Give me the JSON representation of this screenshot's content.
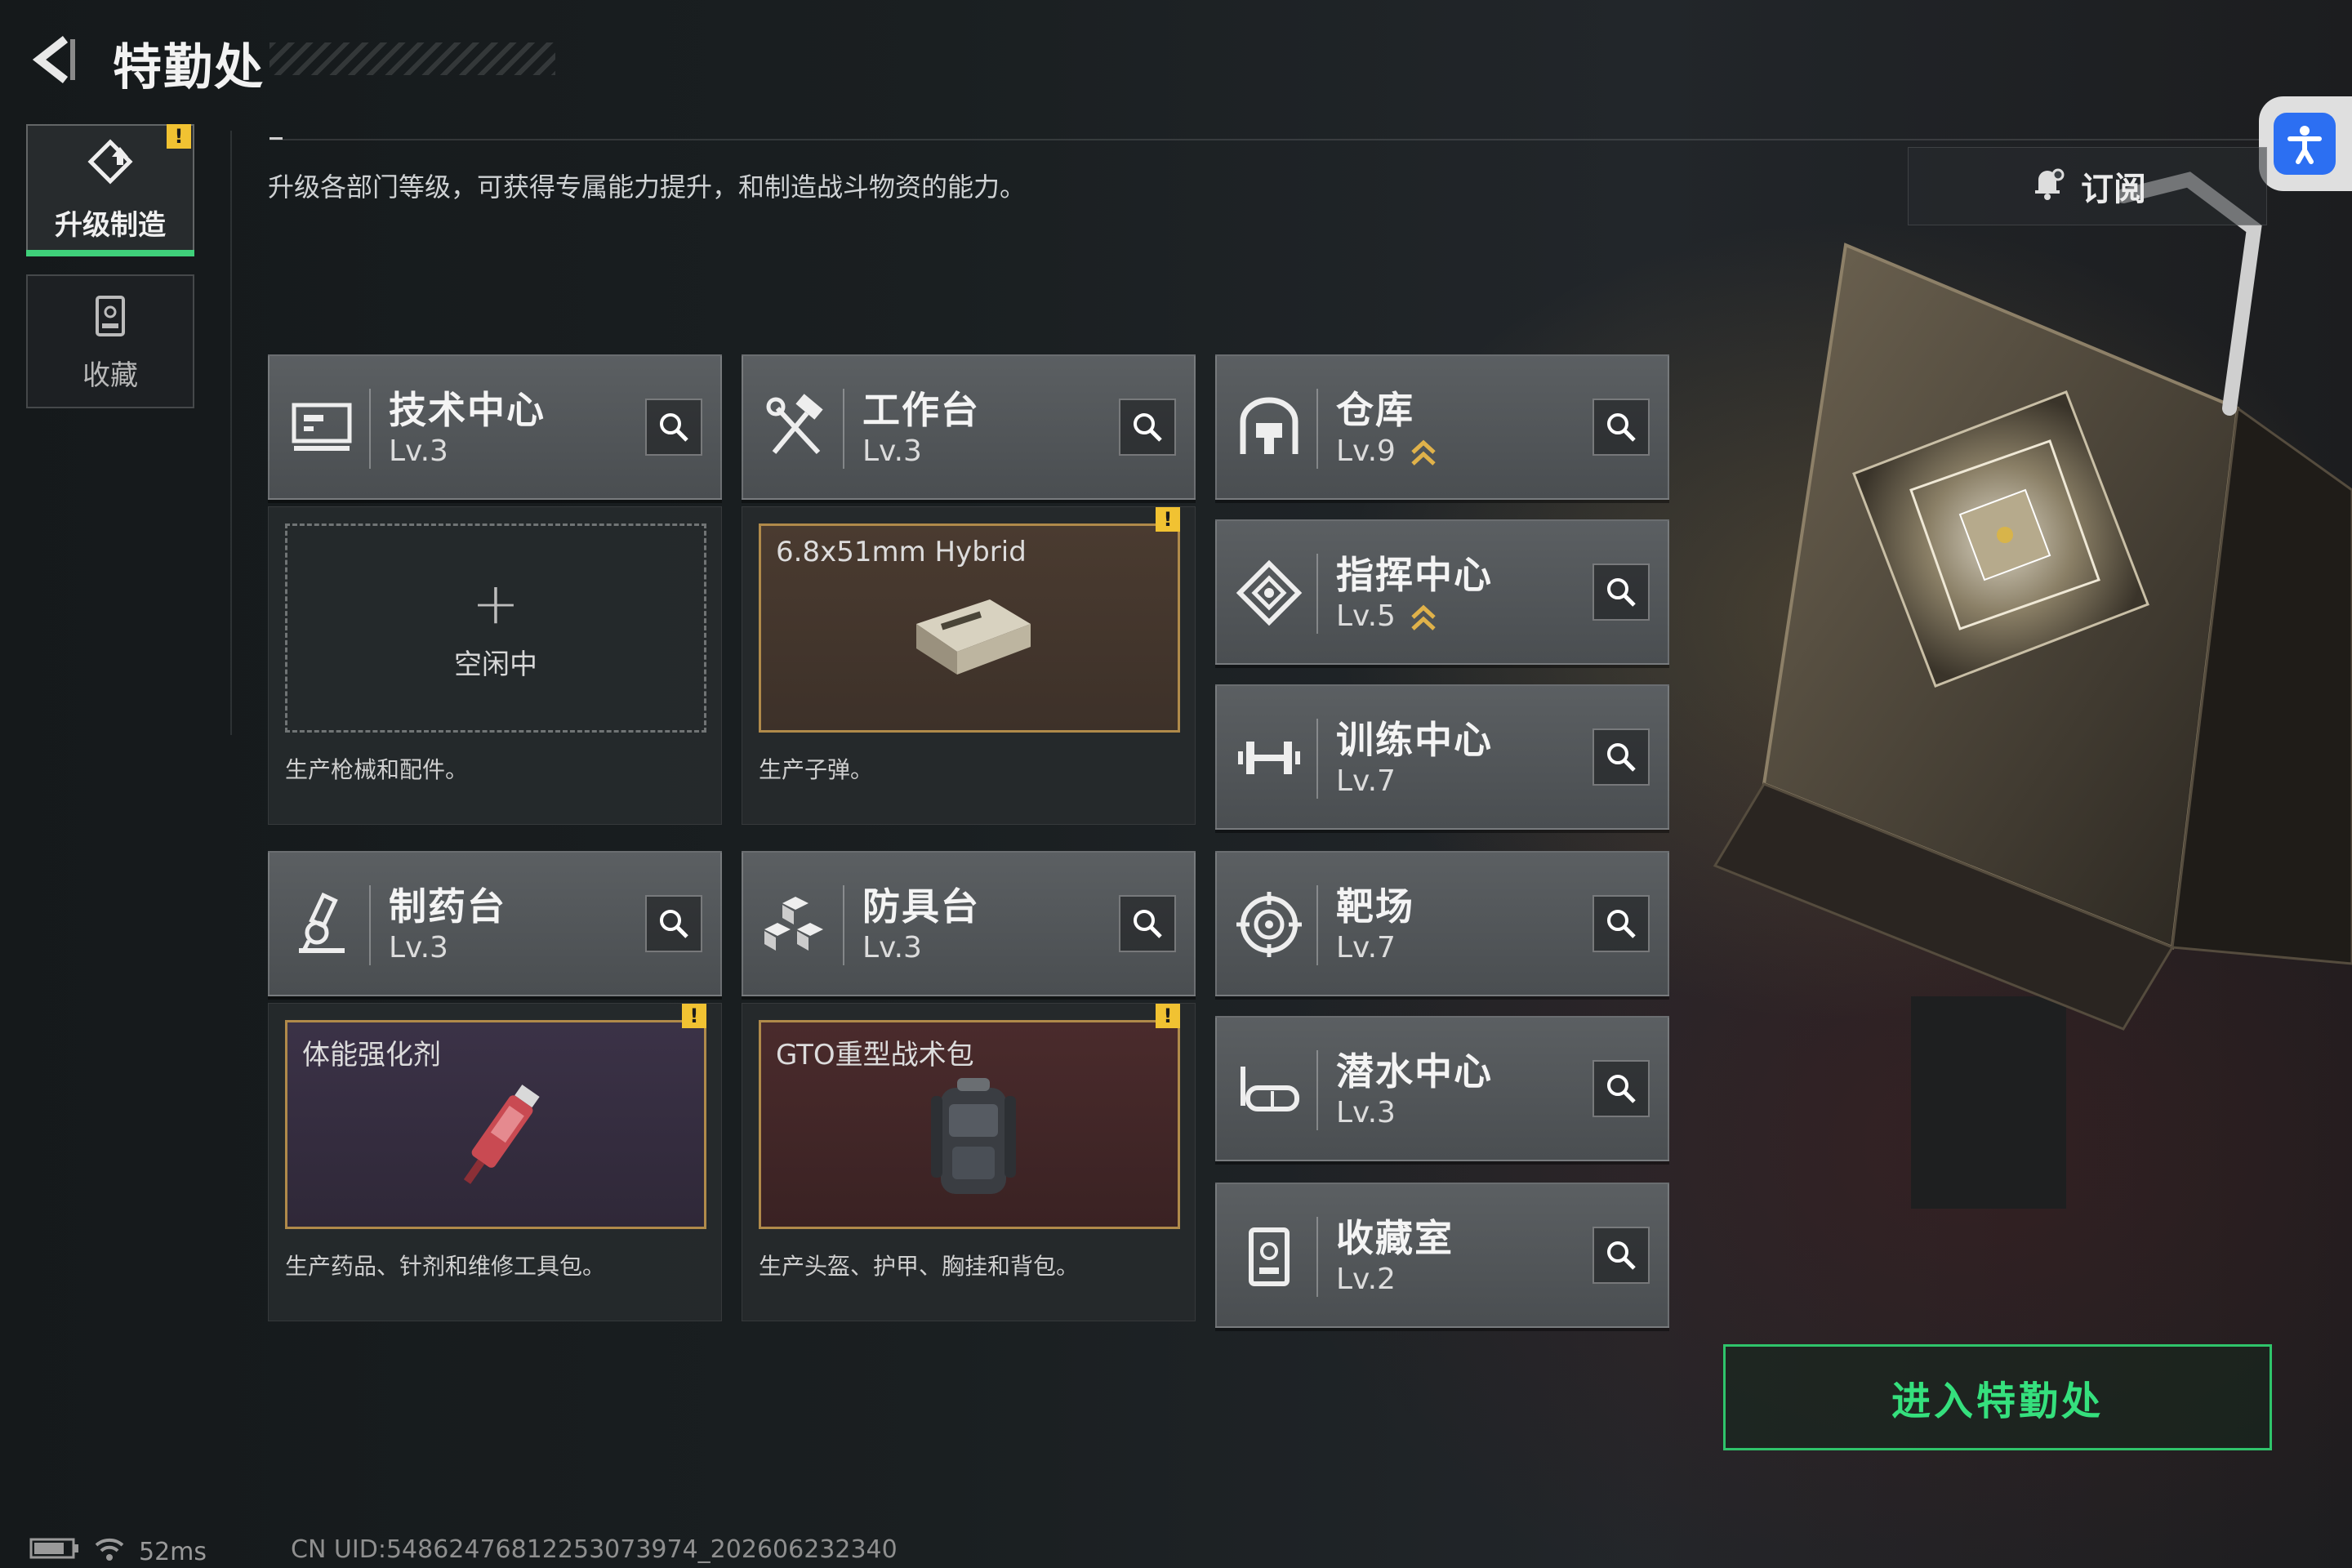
{
  "header": {
    "title": "特勤处",
    "subtitle": "升级各部门等级，可获得专属能力提升，和制造战斗物资的能力。",
    "subscribe_label": "订阅"
  },
  "sidebar": {
    "items": [
      {
        "label": "升级制造",
        "active": true,
        "has_alert": true,
        "alert_text": "!"
      },
      {
        "label": "收藏",
        "active": false
      }
    ]
  },
  "departments": {
    "tech": {
      "name": "技术中心",
      "level": "Lv.3",
      "icon": "monitor-icon"
    },
    "workbench": {
      "name": "工作台",
      "level": "Lv.3",
      "icon": "hammer-wrench-icon"
    },
    "pharmacy": {
      "name": "制药台",
      "level": "Lv.3",
      "icon": "microscope-icon"
    },
    "armor": {
      "name": "防具台",
      "level": "Lv.3",
      "icon": "cubes-icon"
    },
    "warehouse": {
      "name": "仓库",
      "level": "Lv.9",
      "icon": "garage-icon",
      "upgrade": true
    },
    "command": {
      "name": "指挥中心",
      "level": "Lv.5",
      "icon": "diamond-target-icon",
      "upgrade": true
    },
    "training": {
      "name": "训练中心",
      "level": "Lv.7",
      "icon": "dumbbell-icon"
    },
    "range": {
      "name": "靶场",
      "level": "Lv.7",
      "icon": "crosshair-icon"
    },
    "diving": {
      "name": "潜水中心",
      "level": "Lv.3",
      "icon": "diving-mask-icon"
    },
    "collection": {
      "name": "收藏室",
      "level": "Lv.2",
      "icon": "display-case-icon"
    }
  },
  "production": {
    "tech": {
      "state": "空闲中",
      "description": "生产枪械和配件。"
    },
    "workbench": {
      "item": "6.8x51mm Hybrid",
      "description": "生产子弹。",
      "alert": "!"
    },
    "pharmacy": {
      "item": "体能强化剂",
      "description": "生产药品、针剂和维修工具包。",
      "alert": "!"
    },
    "armor": {
      "item": "GTO重型战术包",
      "description": "生产头盔、护甲、胸挂和背包。",
      "alert": "!"
    }
  },
  "enter_button": "进入特勤处",
  "status_bar": {
    "latency": "52ms",
    "uid": "CN UID:548624768122530739​74_202606232340"
  },
  "colors": {
    "accent_green": "#35e07d",
    "alert_yellow": "#f1c232",
    "accessibility_blue": "#2c6ff2"
  }
}
